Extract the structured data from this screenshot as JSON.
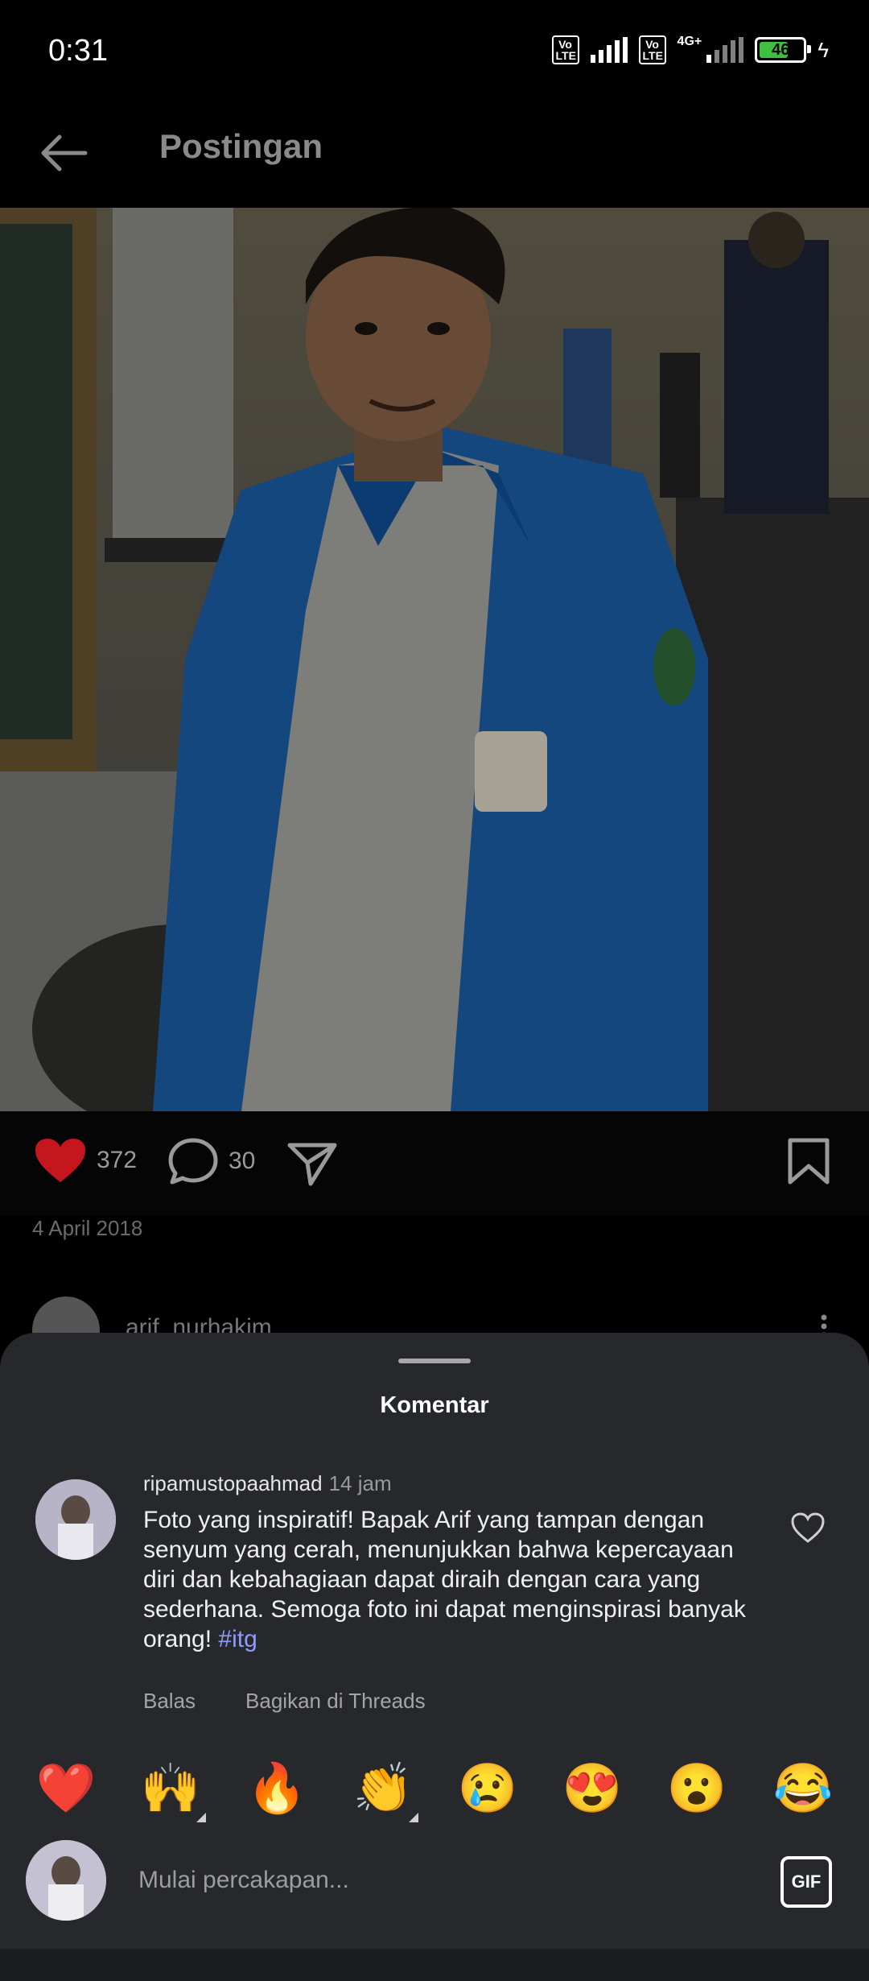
{
  "status": {
    "time": "0:31",
    "network": "4G+",
    "battery": "46",
    "volte1": "Vo LTE",
    "volte2": "Vo LTE"
  },
  "header": {
    "title": "Postingan"
  },
  "post": {
    "likes": "372",
    "comments": "30",
    "date": "4 April 2018",
    "author": "arif_nurhakim"
  },
  "sheet": {
    "title": "Komentar",
    "comment": {
      "username": "ripamustopaahmad",
      "time": "14 jam",
      "text": "Foto yang inspiratif! Bapak Arif yang tampan dengan senyum yang cerah, menunjukkan bahwa kepercayaan diri dan kebahagiaan dapat diraih dengan cara yang sederhana. Semoga foto ini dapat menginspirasi banyak orang!",
      "hashtag": "#itg",
      "reply": "Balas",
      "share": "Bagikan di Threads"
    },
    "emojis": [
      "❤️",
      "🙌",
      "🔥",
      "👏",
      "😢",
      "😍",
      "😮",
      "😂"
    ],
    "input_placeholder": "Mulai percakapan...",
    "gif_label": "GIF"
  },
  "colors": {
    "like_red": "#c4161c",
    "hashtag": "#8f9bff",
    "sheet_bg": "#26282c"
  }
}
